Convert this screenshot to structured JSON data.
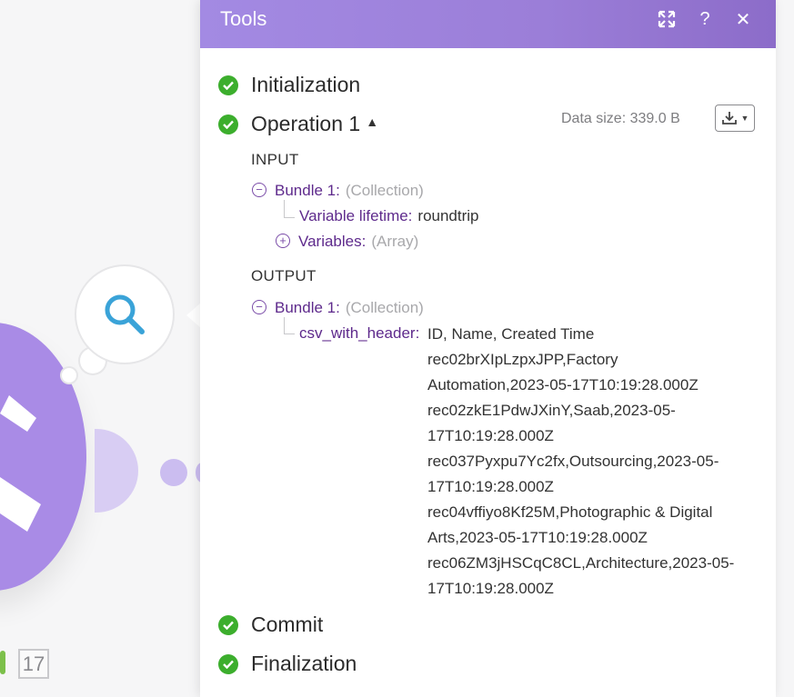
{
  "canvas": {
    "module_counter": "17"
  },
  "panel": {
    "title": "Tools",
    "icons": {
      "expand": "expand-icon",
      "help": "?",
      "close": "✕"
    },
    "steps": {
      "initialization": "Initialization",
      "operation": "Operation 1",
      "commit": "Commit",
      "finalization": "Finalization"
    },
    "data_size": "Data size: 339.0 B",
    "input": {
      "heading": "INPUT",
      "bundle_key": "Bundle 1:",
      "bundle_type": "(Collection)",
      "variable_lifetime_key": "Variable lifetime:",
      "variable_lifetime_value": "roundtrip",
      "variables_key": "Variables:",
      "variables_type": "(Array)"
    },
    "output": {
      "heading": "OUTPUT",
      "bundle_key": "Bundle 1:",
      "bundle_type": "(Collection)",
      "csv_key": "csv_with_header:",
      "csv_lines": [
        "ID, Name, Created Time",
        "rec02brXIpLzpxJPP,Factory",
        "Automation,2023-05-17T10:19:28.000Z",
        "rec02zkE1PdwJXinY,Saab,2023-05-",
        "17T10:19:28.000Z",
        "rec037Pyxpu7Yc2fx,Outsourcing,2023-05-",
        "17T10:19:28.000Z",
        "rec04vffiyo8Kf25M,Photographic & Digital",
        "Arts,2023-05-17T10:19:28.000Z",
        "rec06ZM3jHSCqC8CL,Architecture,2023-05-",
        "17T10:19:28.000Z"
      ]
    }
  },
  "colors": {
    "header": "#9b7ed8",
    "check": "#3cae2d",
    "key": "#5e2a8c",
    "module": "#a98be6"
  }
}
